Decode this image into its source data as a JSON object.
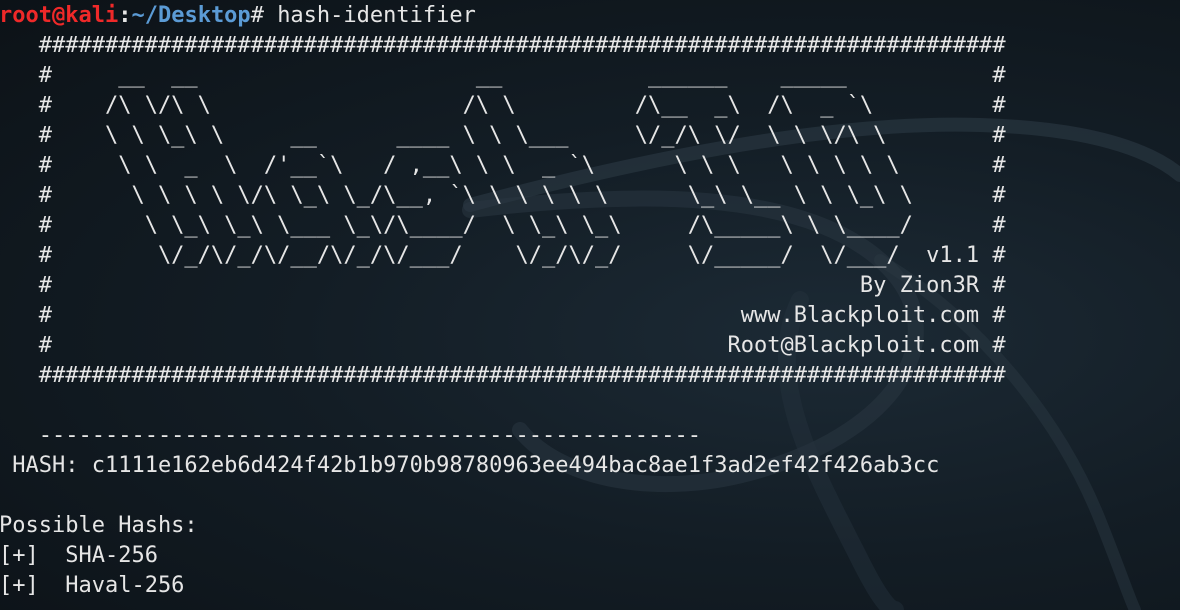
{
  "terminal": {
    "prompt": {
      "user_host": "root@kali",
      "separator": ":",
      "path": "~/Desktop",
      "symbol": "# ",
      "command": "hash-identifier"
    },
    "banner": [
      "   #########################################################################",
      "   #     __  __                     __           ______    _____           #",
      "   #    /\\ \\/\\ \\                   /\\ \\         /\\__  _\\  /\\  _ `\\         #",
      "   #    \\ \\ \\_\\ \\     __      ____ \\ \\ \\___     \\/_/\\ \\/  \\ \\ \\/\\ \\        #",
      "   #     \\ \\  _  \\  /'__`\\   / ,__\\ \\ \\  _ `\\      \\ \\ \\   \\ \\ \\ \\ \\       #",
      "   #      \\ \\ \\ \\ \\/\\ \\_\\ \\_/\\__, `\\ \\ \\ \\ \\ \\      \\_\\ \\__ \\ \\ \\_\\ \\      #",
      "   #       \\ \\_\\ \\_\\ \\___ \\_\\/\\____/  \\ \\_\\ \\_\\     /\\_____\\ \\ \\____/      #",
      "   #        \\/_/\\/_/\\/__/\\/_/\\/___/    \\/_/\\/_/     \\/_____/  \\/___/  v1.1 #",
      "   #                                                             By Zion3R #",
      "   #                                                    www.Blackploit.com #",
      "   #                                                   Root@Blackploit.com #",
      "   #########################################################################"
    ],
    "blank_line": "",
    "separator_line": "   --------------------------------------------------",
    "hash_line": " HASH: c1111e162eb6d424f42b1b970b98780963ee494bac8ae1f3ad2ef42f426ab3cc",
    "blank_line_2": "",
    "results_title": "Possible Hashs:",
    "results": [
      "[+]  SHA-256",
      "[+]  Haval-256"
    ]
  },
  "colors": {
    "background": "#131d25",
    "text": "#e6e6e6",
    "prompt_user": "#ef2929",
    "prompt_path": "#5b9bd5",
    "wallpaper_stroke": "#2b3a45"
  }
}
